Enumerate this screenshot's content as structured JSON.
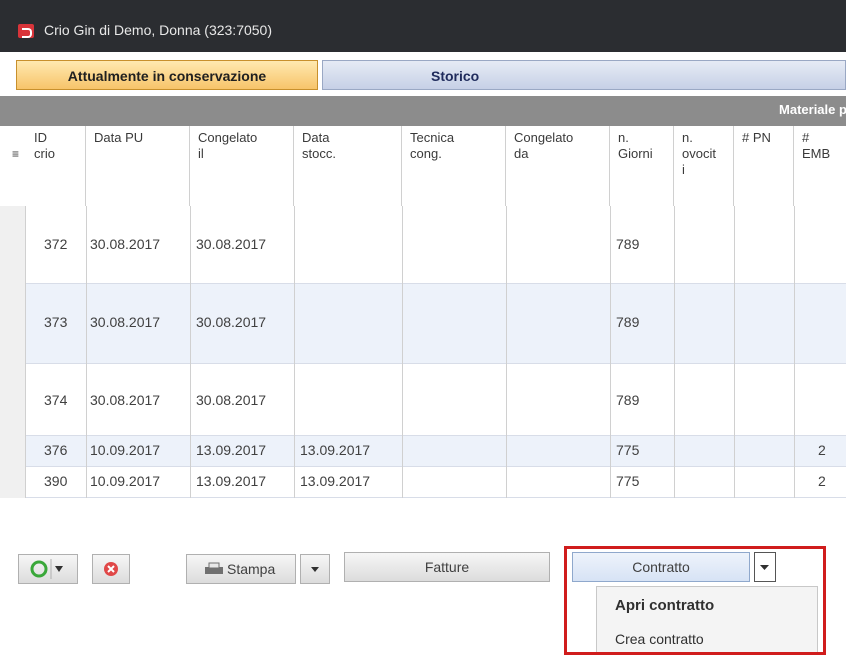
{
  "window": {
    "title": "Crio Gin di Demo, Donna (323:7050)"
  },
  "tabs": [
    {
      "label": "Attualmente in conservazione",
      "active": true
    },
    {
      "label": "Storico",
      "active": false
    }
  ],
  "section_header": "Materiale pr",
  "table": {
    "columns": [
      "ID\ncrio",
      "Data PU",
      "Congelato\nil",
      "Data\nstocc.",
      "Tecnica\ncong.",
      "Congelato\nda",
      "n.\nGiorni",
      "n.\novocit\ni",
      "# PN",
      "#\nEMB"
    ],
    "sort_glyph": "≡",
    "rows": [
      {
        "id": "372",
        "data_pu": "30.08.2017",
        "congelato_il": "30.08.2017",
        "data_stocc": "",
        "tecnica": "",
        "congelato_da": "",
        "giorni": "789",
        "ovociti": "",
        "pn": "",
        "emb": ""
      },
      {
        "id": "373",
        "data_pu": "30.08.2017",
        "congelato_il": "30.08.2017",
        "data_stocc": "",
        "tecnica": "",
        "congelato_da": "",
        "giorni": "789",
        "ovociti": "",
        "pn": "",
        "emb": ""
      },
      {
        "id": "374",
        "data_pu": "30.08.2017",
        "congelato_il": "30.08.2017",
        "data_stocc": "",
        "tecnica": "",
        "congelato_da": "",
        "giorni": "789",
        "ovociti": "",
        "pn": "",
        "emb": ""
      },
      {
        "id": "376",
        "data_pu": "10.09.2017",
        "congelato_il": "13.09.2017",
        "data_stocc": "13.09.2017",
        "tecnica": "",
        "congelato_da": "",
        "giorni": "775",
        "ovociti": "",
        "pn": "",
        "emb": "2"
      },
      {
        "id": "390",
        "data_pu": "10.09.2017",
        "congelato_il": "13.09.2017",
        "data_stocc": "13.09.2017",
        "tecnica": "",
        "congelato_da": "",
        "giorni": "775",
        "ovociti": "",
        "pn": "",
        "emb": "2"
      }
    ],
    "current_row_marker": "▸"
  },
  "toolbar": {
    "stampa_label": "Stampa",
    "fatture_label": "Fatture",
    "contratto_label": "Contratto"
  },
  "contratto_menu": [
    "Apri contratto",
    "Crea contratto"
  ],
  "colors": {
    "highlight_red": "#d01c1c",
    "tab_active": "#f7c46a",
    "tab_inactive": "#c6d0e6",
    "title_bar": "#2b2d31"
  },
  "icons": [
    "app-icon",
    "refresh-icon",
    "delete-icon",
    "printer-icon",
    "chevron-down-icon"
  ]
}
